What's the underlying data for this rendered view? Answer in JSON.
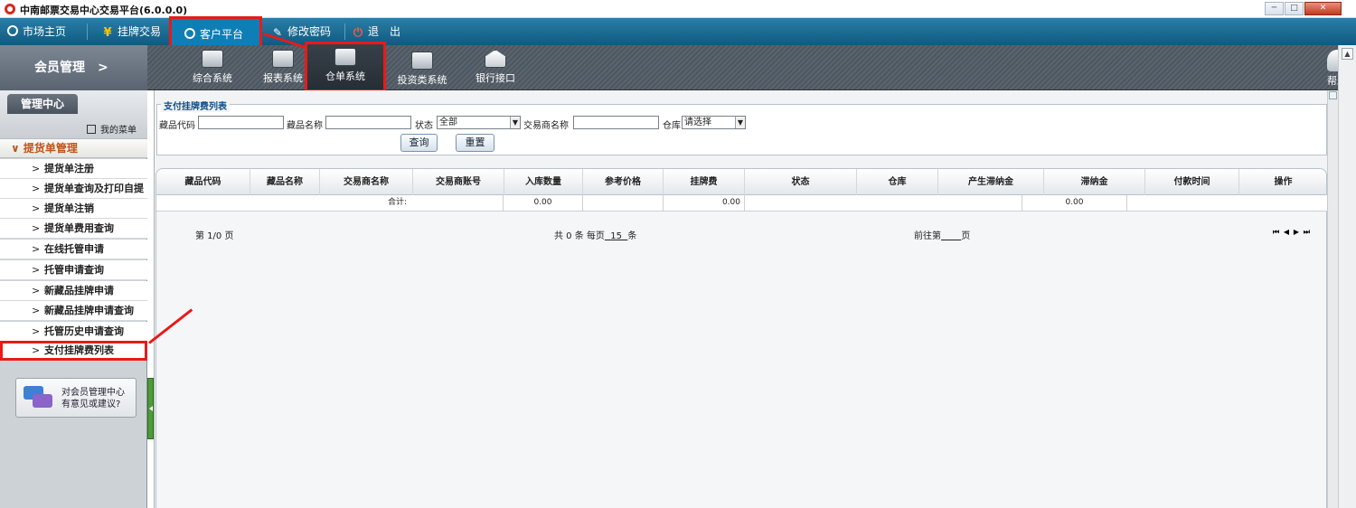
{
  "window": {
    "title": "中南邮票交易中心交易平台(6.0.0.0)"
  },
  "top_menu": {
    "items": [
      {
        "label": "市场主页",
        "icon": "market-icon"
      },
      {
        "label": "挂牌交易",
        "icon": "yen-icon"
      },
      {
        "label": "客户平台",
        "icon": "client-icon"
      },
      {
        "label": "修改密码",
        "icon": "edit-icon"
      },
      {
        "label": "退　出",
        "icon": "power-icon"
      }
    ]
  },
  "module_bar": {
    "section": "会员管理　>",
    "modules": [
      {
        "label": "综合系统"
      },
      {
        "label": "报表系统"
      },
      {
        "label": "仓单系统"
      },
      {
        "label": "投资类系统"
      },
      {
        "label": "银行接口"
      }
    ],
    "help": "帮助"
  },
  "sidebar": {
    "tab": "管理中心",
    "my_menu": "我的菜单",
    "group": "提货单管理",
    "items": [
      "提货单注册",
      "提货单查询及打印自提",
      "提货单注销",
      "提货单费用查询",
      "在线托管申请",
      "托管申请查询",
      "新藏品挂牌申请",
      "新藏品挂牌申请查询",
      "托管历史申请查询",
      "支付挂牌费列表"
    ],
    "feedback": {
      "line1": "对会员管理中心",
      "line2": "有意见或建议?"
    }
  },
  "filter": {
    "legend": "支付挂牌费列表",
    "code_label": "藏品代码",
    "name_label": "藏品名称",
    "status_label": "状态",
    "status_value": "全部",
    "trader_label": "交易商名称",
    "warehouse_label": "仓库",
    "warehouse_value": "请选择",
    "query_button": "查询",
    "reset_button": "重置"
  },
  "grid": {
    "columns": [
      "藏品代码",
      "藏品名称",
      "交易商名称",
      "交易商账号",
      "入库数量",
      "参考价格",
      "挂牌费",
      "状态",
      "仓库",
      "产生滞纳金",
      "滞纳金",
      "付款时间",
      "操作"
    ],
    "sum_label": "合计:",
    "sum_qty": "0.00",
    "sum_fee": "0.00",
    "sum_latefee": "0.00"
  },
  "pager": {
    "page_info": "第 1/0 页",
    "total_prefix": "共 0 条 每页",
    "page_size": "15",
    "total_suffix": "条",
    "goto_prefix": "前往第",
    "goto_suffix": "页",
    "nav": "⏮ ◀ ▶ ⏭"
  }
}
